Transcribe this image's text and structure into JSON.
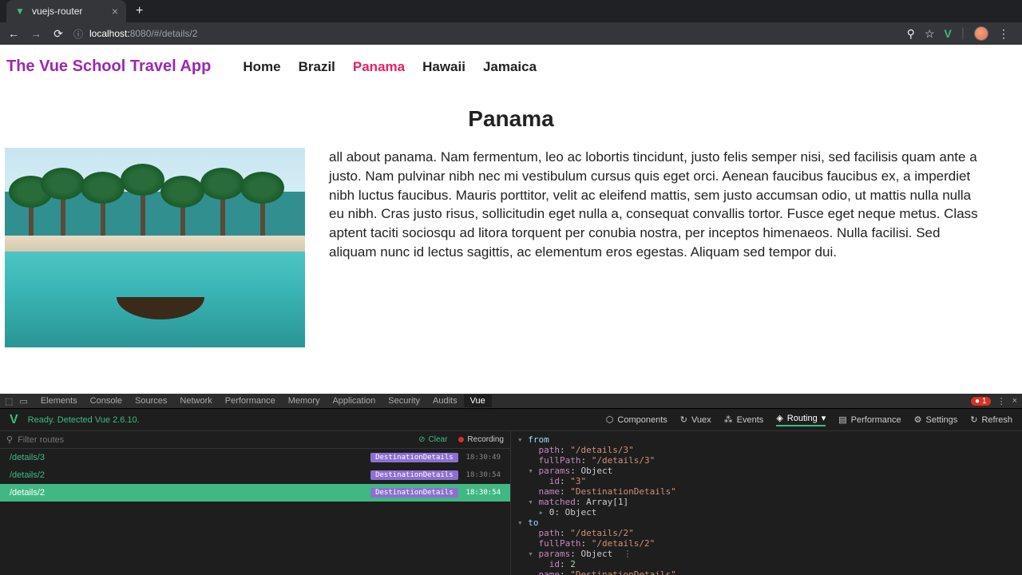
{
  "browser": {
    "tab_title": "vuejs-router",
    "url_host": "localhost:",
    "url_port_path": "8080/#/details/2"
  },
  "app": {
    "title": "The Vue School Travel App",
    "nav": [
      {
        "label": "Home",
        "active": false
      },
      {
        "label": "Brazil",
        "active": false
      },
      {
        "label": "Panama",
        "active": true
      },
      {
        "label": "Hawaii",
        "active": false
      },
      {
        "label": "Jamaica",
        "active": false
      }
    ],
    "page_title": "Panama",
    "description": "all about panama. Nam fermentum, leo ac lobortis tincidunt, justo felis semper nisi, sed facilisis quam ante a justo. Nam pulvinar nibh nec mi vestibulum cursus quis eget orci. Aenean faucibus faucibus ex, a imperdiet nibh luctus faucibus. Mauris porttitor, velit ac eleifend mattis, sem justo accumsan odio, ut mattis nulla nulla eu nibh. Cras justo risus, sollicitudin eget nulla a, consequat convallis tortor. Fusce eget neque metus. Class aptent taciti sociosqu ad litora torquent per conubia nostra, per inceptos himenaeos. Nulla facilisi. Sed aliquam nunc id lectus sagittis, ac elementum eros egestas. Aliquam sed tempor dui."
  },
  "devtools": {
    "tabs": [
      "Elements",
      "Console",
      "Sources",
      "Network",
      "Performance",
      "Memory",
      "Application",
      "Security",
      "Audits",
      "Vue"
    ],
    "active_tab": "Vue",
    "error_count": "1",
    "vue_status": "Ready. Detected Vue 2.6.10.",
    "vue_nav": [
      {
        "icon": "⬡",
        "label": "Components"
      },
      {
        "icon": "↻",
        "label": "Vuex"
      },
      {
        "icon": "⁂",
        "label": "Events"
      },
      {
        "icon": "◈",
        "label": "Routing",
        "active": true,
        "chevron": true
      },
      {
        "icon": "▤",
        "label": "Performance"
      },
      {
        "icon": "⚙",
        "label": "Settings"
      },
      {
        "icon": "↻",
        "label": "Refresh"
      }
    ],
    "filter_placeholder": "Filter routes",
    "clear_label": "Clear",
    "recording_label": "Recording",
    "routes": [
      {
        "path": "/details/3",
        "component": "DestinationDetails",
        "time": "18:30:49",
        "selected": false
      },
      {
        "path": "/details/2",
        "component": "DestinationDetails",
        "time": "18:30:54",
        "selected": false
      },
      {
        "path": "/details/2",
        "component": "DestinationDetails",
        "time": "18:30:54",
        "selected": true
      }
    ],
    "inspector": {
      "from": {
        "path": "/details/3",
        "fullPath": "/details/3",
        "params_id": "3",
        "name": "DestinationDetails",
        "matched": "Array[1]"
      },
      "to": {
        "path": "/details/2",
        "fullPath": "/details/2",
        "params_id": "2",
        "name": "DestinationDetails"
      }
    }
  }
}
